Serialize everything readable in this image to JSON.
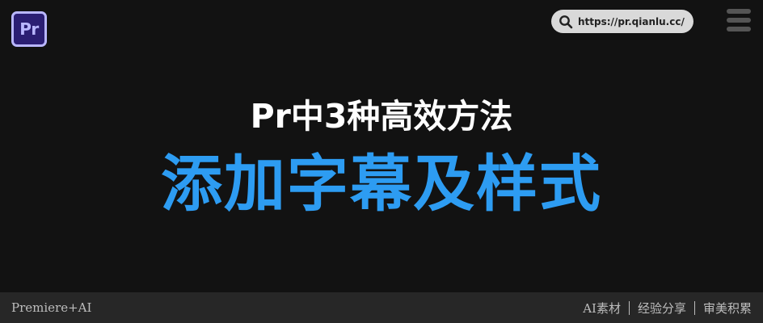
{
  "app": {
    "logo_text": "Pr",
    "colors": {
      "background": "#121212",
      "logo_bg": "#2b1e73",
      "logo_fg": "#b9b6ff",
      "title_accent": "#2d9cf2",
      "footer_bg": "#272727"
    }
  },
  "header": {
    "url": "https://pr.qianlu.cc/",
    "search_icon": "search-icon",
    "menu_icon": "hamburger-menu-icon"
  },
  "main": {
    "subtitle": "Pr中3种高效方法",
    "title": "添加字幕及样式"
  },
  "footer": {
    "left_label": "Premiere+AI",
    "tags": [
      "AI素材",
      "经验分享",
      "审美积累"
    ]
  }
}
